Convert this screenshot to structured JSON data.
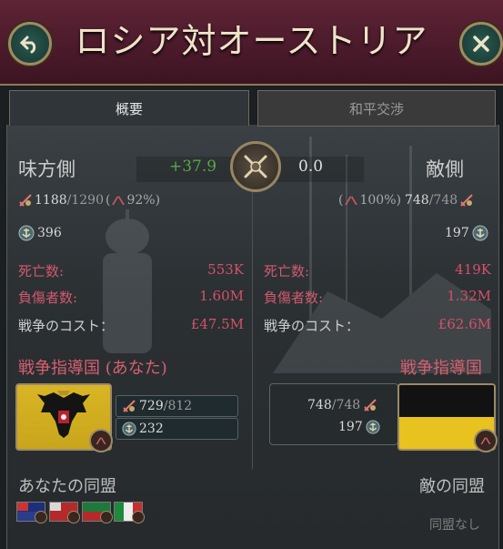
{
  "header": {
    "title": "ロシア対オーストリア"
  },
  "tabs": {
    "overview": "概要",
    "peace": "和平交渉"
  },
  "allies": {
    "title": "味方側",
    "score": "+37.9",
    "manpower_current": "1188",
    "manpower_total": "/1290",
    "morale": "92%",
    "naval": "396",
    "deaths_label": "死亡数:",
    "deaths": "553K",
    "wounded_label": "負傷者数:",
    "wounded": "1.60M",
    "cost_label": "戦争のコスト：",
    "cost": "£47.5M",
    "leader_title": "戦争指導国 (あなた)",
    "leader_manpower_current": "729",
    "leader_manpower_total": "/812",
    "leader_naval": "232",
    "allies_title": "あなたの同盟"
  },
  "enemies": {
    "title": "敵側",
    "score": "0.0",
    "morale": "100%",
    "manpower_current": "748",
    "manpower_total": "/748",
    "naval": "197",
    "deaths_label": "死亡数:",
    "deaths": "419K",
    "wounded_label": "負傷者数:",
    "wounded": "1.32M",
    "cost_label": "戦争のコスト：",
    "cost": "£62.6M",
    "leader_title": "戦争指導国",
    "leader_manpower_current": "748",
    "leader_manpower_total": "/748",
    "leader_naval": "197",
    "allies_title": "敵の同盟",
    "no_allies": "同盟なし"
  },
  "icons": {
    "back": "back-arrow-icon",
    "close": "close-icon",
    "army": "army-icon",
    "morale": "morale-icon",
    "navy": "navy-anchor-icon",
    "emblem": "crossed-swords-emblem-icon"
  },
  "colors": {
    "header_bg": "#4a1a2a",
    "positive_score": "#56a844",
    "loss_value": "#d55068",
    "leader_title": "#d85f70",
    "frame_gold": "#9a8a66"
  }
}
